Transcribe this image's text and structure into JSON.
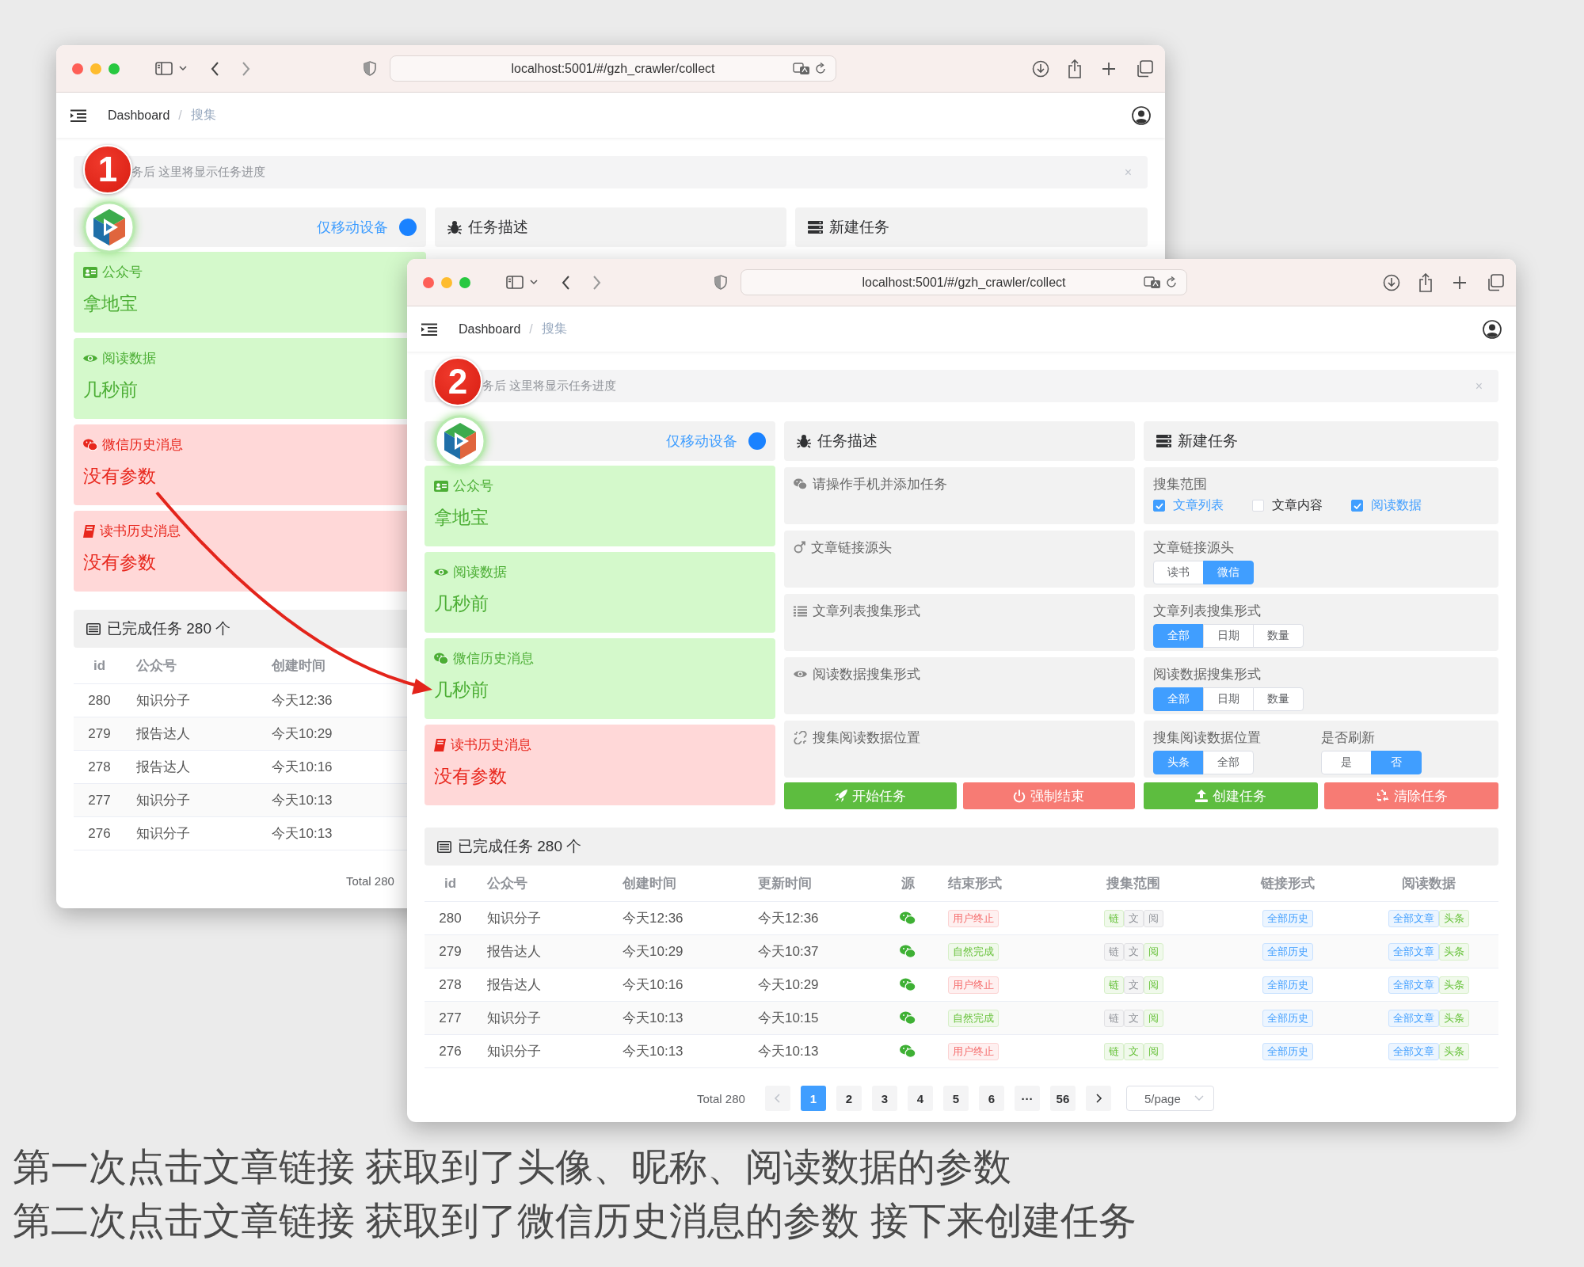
{
  "windows": [
    {
      "url": "localhost:5001/#/gzh_crawler/collect",
      "breadcrumb": [
        "Dashboard",
        "搜集"
      ],
      "separator": "/",
      "alert": {
        "text": "务后 这里将显示任务进度",
        "close": "×"
      },
      "device_toggle": {
        "label": "仅移动设备",
        "on": true
      },
      "panels": [
        {
          "title": "任务描述"
        },
        {
          "title": "新建任务"
        }
      ],
      "status_cards": [
        {
          "title": "公众号",
          "value": "拿地宝",
          "ok": true
        },
        {
          "title": "阅读数据",
          "value": "几秒前",
          "ok": true
        },
        {
          "title": "微信历史消息",
          "value": "没有参数",
          "ok": false
        },
        {
          "title": "读书历史消息",
          "value": "没有参数",
          "ok": false
        }
      ],
      "completed": {
        "title": "已完成任务 280 个",
        "columns": [
          "id",
          "公众号",
          "创建时间"
        ],
        "rows": [
          {
            "id": "280",
            "name": "知识分子",
            "created": "今天12:36"
          },
          {
            "id": "279",
            "name": "报告达人",
            "created": "今天10:29"
          },
          {
            "id": "278",
            "name": "报告达人",
            "created": "今天10:16"
          },
          {
            "id": "277",
            "name": "知识分子",
            "created": "今天10:13"
          },
          {
            "id": "276",
            "name": "知识分子",
            "created": "今天10:13"
          }
        ],
        "pagination": {
          "total": "Total 280"
        }
      }
    },
    {
      "url": "localhost:5001/#/gzh_crawler/collect",
      "breadcrumb": [
        "Dashboard",
        "搜集"
      ],
      "separator": "/",
      "alert": {
        "text": "务后 这里将显示任务进度",
        "close": "×"
      },
      "device_toggle": {
        "label": "仅移动设备",
        "on": true
      },
      "panels": [
        {
          "title": "任务描述",
          "items": [
            "请操作手机并添加任务",
            "文章链接源头",
            "文章列表搜集形式",
            "阅读数据搜集形式",
            "搜集阅读数据位置"
          ],
          "actions": [
            {
              "label": "开始任务",
              "kind": "success"
            },
            {
              "label": "强制结束",
              "kind": "danger"
            }
          ]
        },
        {
          "title": "新建任务",
          "rows": [
            {
              "groups": [
                {
                  "label": "搜集范围",
                  "kind": "checkboxes",
                  "options": [
                    {
                      "label": "文章列表",
                      "checked": true
                    },
                    {
                      "label": "文章内容",
                      "checked": false
                    },
                    {
                      "label": "阅读数据",
                      "checked": true
                    }
                  ]
                }
              ]
            },
            {
              "groups": [
                {
                  "label": "文章链接源头",
                  "kind": "segmented",
                  "options": [
                    {
                      "label": "读书",
                      "selected": false
                    },
                    {
                      "label": "微信",
                      "selected": true
                    }
                  ]
                }
              ]
            },
            {
              "groups": [
                {
                  "label": "文章列表搜集形式",
                  "kind": "segmented",
                  "options": [
                    {
                      "label": "全部",
                      "selected": true
                    },
                    {
                      "label": "日期",
                      "selected": false
                    },
                    {
                      "label": "数量",
                      "selected": false
                    }
                  ]
                }
              ]
            },
            {
              "groups": [
                {
                  "label": "阅读数据搜集形式",
                  "kind": "segmented",
                  "options": [
                    {
                      "label": "全部",
                      "selected": true
                    },
                    {
                      "label": "日期",
                      "selected": false
                    },
                    {
                      "label": "数量",
                      "selected": false
                    }
                  ]
                }
              ]
            },
            {
              "groups": [
                {
                  "label": "搜集阅读数据位置",
                  "kind": "segmented",
                  "options": [
                    {
                      "label": "头条",
                      "selected": true
                    },
                    {
                      "label": "全部",
                      "selected": false
                    }
                  ]
                },
                {
                  "label": "是否刷新",
                  "kind": "segmented",
                  "options": [
                    {
                      "label": "是",
                      "selected": false
                    },
                    {
                      "label": "否",
                      "selected": true
                    }
                  ]
                }
              ]
            }
          ],
          "actions": [
            {
              "label": "创建任务",
              "kind": "success"
            },
            {
              "label": "清除任务",
              "kind": "danger"
            }
          ]
        }
      ],
      "status_cards": [
        {
          "title": "公众号",
          "value": "拿地宝",
          "ok": true
        },
        {
          "title": "阅读数据",
          "value": "几秒前",
          "ok": true
        },
        {
          "title": "微信历史消息",
          "value": "几秒前",
          "ok": true
        },
        {
          "title": "读书历史消息",
          "value": "没有参数",
          "ok": false
        }
      ],
      "completed": {
        "title": "已完成任务 280 个",
        "columns": [
          "id",
          "公众号",
          "创建时间",
          "更新时间",
          "源",
          "结束形式",
          "搜集范围",
          "链接形式",
          "阅读数据"
        ],
        "rows": [
          {
            "id": "280",
            "name": "知识分子",
            "created": "今天12:36",
            "updated": "今天12:36",
            "end": {
              "text": "用户终止",
              "kind": "danger"
            },
            "scope": [
              {
                "text": "链",
                "on": true
              },
              {
                "text": "文",
                "on": false
              },
              {
                "text": "阅",
                "on": false
              }
            ],
            "link": "全部历史",
            "read": [
              "全部文章",
              "头条"
            ]
          },
          {
            "id": "279",
            "name": "报告达人",
            "created": "今天10:29",
            "updated": "今天10:37",
            "end": {
              "text": "自然完成",
              "kind": "success"
            },
            "scope": [
              {
                "text": "链",
                "on": false
              },
              {
                "text": "文",
                "on": false
              },
              {
                "text": "阅",
                "on": true
              }
            ],
            "link": "全部历史",
            "read": [
              "全部文章",
              "头条"
            ]
          },
          {
            "id": "278",
            "name": "报告达人",
            "created": "今天10:16",
            "updated": "今天10:29",
            "end": {
              "text": "用户终止",
              "kind": "danger"
            },
            "scope": [
              {
                "text": "链",
                "on": true
              },
              {
                "text": "文",
                "on": false
              },
              {
                "text": "阅",
                "on": true
              }
            ],
            "link": "全部历史",
            "read": [
              "全部文章",
              "头条"
            ]
          },
          {
            "id": "277",
            "name": "知识分子",
            "created": "今天10:13",
            "updated": "今天10:15",
            "end": {
              "text": "自然完成",
              "kind": "success"
            },
            "scope": [
              {
                "text": "链",
                "on": false
              },
              {
                "text": "文",
                "on": false
              },
              {
                "text": "阅",
                "on": true
              }
            ],
            "link": "全部历史",
            "read": [
              "全部文章",
              "头条"
            ]
          },
          {
            "id": "276",
            "name": "知识分子",
            "created": "今天10:13",
            "updated": "今天10:13",
            "end": {
              "text": "用户终止",
              "kind": "danger"
            },
            "scope": [
              {
                "text": "链",
                "on": true
              },
              {
                "text": "文",
                "on": true
              },
              {
                "text": "阅",
                "on": true
              }
            ],
            "link": "全部历史",
            "read": [
              "全部文章",
              "头条"
            ]
          }
        ],
        "pagination": {
          "total": "Total 280",
          "prev": {
            "disabled": true
          },
          "next": {
            "disabled": false
          },
          "pages": [
            {
              "label": "1",
              "selected": true
            },
            {
              "label": "2",
              "selected": false
            },
            {
              "label": "3",
              "selected": false
            },
            {
              "label": "4",
              "selected": false
            },
            {
              "label": "5",
              "selected": false
            },
            {
              "label": "6",
              "selected": false
            },
            {
              "label": "···",
              "selected": false
            },
            {
              "label": "56",
              "selected": false
            }
          ],
          "page_size": "5/page"
        }
      }
    }
  ],
  "annotations": [
    {
      "number": "1"
    },
    {
      "number": "2"
    }
  ],
  "caption": [
    "第一次点击文章链接 获取到了头像、昵称、阅读数据的参数",
    "第二次点击文章链接 获取到了微信历史消息的参数 接下来创建任务"
  ]
}
